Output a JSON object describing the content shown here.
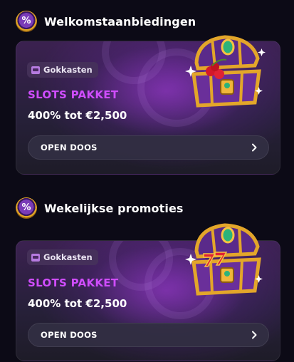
{
  "sections": [
    {
      "title": "Welkomstaanbiedingen",
      "icon": "percent-badge-icon",
      "card": {
        "tag": "Gokkasten",
        "tag_icon": "slot-machine-icon",
        "kicker": "SLOTS PAKKET",
        "offer": "400% tot €2,500",
        "cta": "OPEN DOOS",
        "image": "treasure-chest-cherries-icon"
      }
    },
    {
      "title": "Wekelijkse promoties",
      "icon": "percent-badge-icon",
      "card": {
        "tag": "Gokkasten",
        "tag_icon": "slot-machine-icon",
        "kicker": "SLOTS PAKKET",
        "offer": "400% tot €2,500",
        "cta": "OPEN DOOS",
        "image": "treasure-chest-sevens-icon"
      }
    }
  ],
  "colors": {
    "background": "#0c0a16",
    "kicker": "#d04dff",
    "accent_gold": "#e0a524",
    "accent_purple": "#7a3bb8"
  }
}
